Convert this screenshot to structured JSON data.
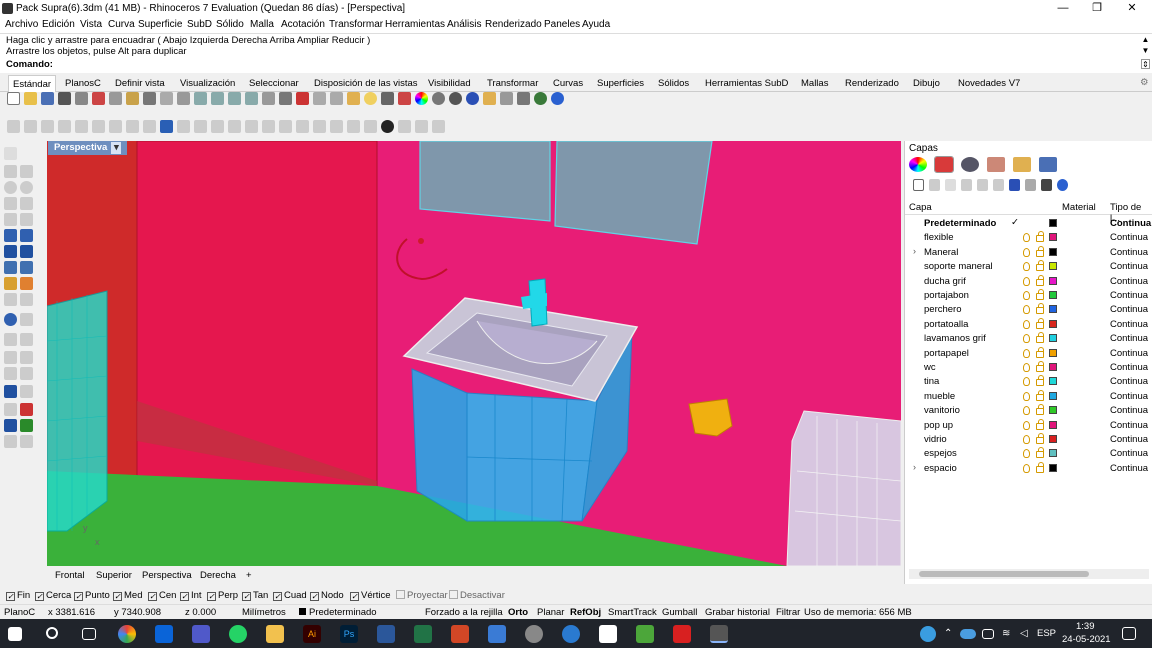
{
  "window": {
    "title": "Pack Supra(6).3dm (41 MB) - Rhinoceros 7 Evaluation (Quedan 86 días) - [Perspectiva]",
    "min": "—",
    "max": "❐",
    "close": "✕"
  },
  "menu": [
    "Archivo",
    "Edición",
    "Vista",
    "Curva",
    "Superficie",
    "SubD",
    "Sólido",
    "Malla",
    "Acotación",
    "Transformar",
    "Herramientas",
    "Análisis",
    "Renderizado",
    "Paneles",
    "Ayuda"
  ],
  "command": {
    "line1": "Haga clic y arrastre para encuadrar ( Abajo  Izquierda  Derecha  Arriba  Ampliar  Reducir )",
    "line2": "Arrastre los objetos, pulse Alt para duplicar",
    "prompt": "Comando:",
    "value": ""
  },
  "toolbar_tabs": [
    "Estándar",
    "PlanosC",
    "Definir vista",
    "Visualización",
    "Seleccionar",
    "Disposición de las vistas",
    "Visibilidad",
    "Transformar",
    "Curvas",
    "Superficies",
    "Sólidos",
    "Herramientas SubD",
    "Mallas",
    "Renderizado",
    "Dibujo",
    "Novedades V7"
  ],
  "viewport": {
    "label": "Perspectiva",
    "menu_glyph": "▾",
    "axis_y": "y",
    "axis_x": "x"
  },
  "viewport_tabs": [
    "Frontal",
    "Superior",
    "Perspectiva",
    "Derecha"
  ],
  "add_tab": "+",
  "osnaps": [
    {
      "label": "Fin",
      "checked": true
    },
    {
      "label": "Cerca",
      "checked": true
    },
    {
      "label": "Punto",
      "checked": true
    },
    {
      "label": "Med",
      "checked": true
    },
    {
      "label": "Cen",
      "checked": true
    },
    {
      "label": "Int",
      "checked": true
    },
    {
      "label": "Perp",
      "checked": true
    },
    {
      "label": "Tan",
      "checked": true
    },
    {
      "label": "Cuad",
      "checked": true
    },
    {
      "label": "Nodo",
      "checked": true
    },
    {
      "label": "Vértice",
      "checked": true
    },
    {
      "label": "Proyectar",
      "checked": false
    },
    {
      "label": "Desactivar",
      "checked": false
    }
  ],
  "status": {
    "cplane": "PlanoC",
    "x": "x 3381.616",
    "y": "y 7340.908",
    "z": "z 0.000",
    "units": "Milímetros",
    "layer": "Predeterminado",
    "grid_snap": "Forzado a la rejilla",
    "ortho": "Orto",
    "planar": "Planar",
    "osnap": "RefObj",
    "smarttrack": "SmartTrack",
    "gumball": "Gumball",
    "history": "Grabar historial",
    "filter": "Filtrar",
    "memory": "Uso de memoria: 656 MB"
  },
  "panel": {
    "title": "Capas",
    "col_layer": "Capa",
    "col_material": "Material",
    "col_linetype": "Tipo de l...",
    "layers": [
      {
        "name": "Predeterminado",
        "current": true,
        "check": "✓",
        "color": "#000000",
        "linetype": "Continua",
        "expand": ""
      },
      {
        "name": "flexible",
        "color": "#e0157a",
        "linetype": "Continua",
        "expand": ""
      },
      {
        "name": "Maneral",
        "color": "#000000",
        "linetype": "Continua",
        "expand": "›"
      },
      {
        "name": "soporte maneral",
        "color": "#c8e600",
        "linetype": "Continua",
        "expand": ""
      },
      {
        "name": "ducha grif",
        "color": "#e617c8",
        "linetype": "Continua",
        "expand": ""
      },
      {
        "name": "portajabon",
        "color": "#22c83c",
        "linetype": "Continua",
        "expand": ""
      },
      {
        "name": "perchero",
        "color": "#2064e0",
        "linetype": "Continua",
        "expand": ""
      },
      {
        "name": "portatoalla",
        "color": "#d8261c",
        "linetype": "Continua",
        "expand": ""
      },
      {
        "name": "lavamanos grif",
        "color": "#20d0e0",
        "linetype": "Continua",
        "expand": ""
      },
      {
        "name": "portapapel",
        "color": "#f0a000",
        "linetype": "Continua",
        "expand": ""
      },
      {
        "name": "wc",
        "color": "#e0157a",
        "linetype": "Continua",
        "expand": ""
      },
      {
        "name": "tina",
        "color": "#20d8d8",
        "linetype": "Continua",
        "expand": ""
      },
      {
        "name": "mueble",
        "color": "#20a8e0",
        "linetype": "Continua",
        "expand": ""
      },
      {
        "name": "vanitorio",
        "color": "#30c828",
        "linetype": "Continua",
        "expand": ""
      },
      {
        "name": "pop up",
        "color": "#e0157a",
        "linetype": "Continua",
        "expand": ""
      },
      {
        "name": "vidrio",
        "color": "#d82020",
        "linetype": "Continua",
        "expand": ""
      },
      {
        "name": "espejos",
        "color": "#60c0c0",
        "linetype": "Continua",
        "expand": ""
      },
      {
        "name": "espacio",
        "color": "#000000",
        "linetype": "Continua",
        "expand": "›"
      }
    ]
  },
  "taskbar": {
    "lang": "ESP",
    "time": "1:39",
    "date": "24-05-2021"
  }
}
